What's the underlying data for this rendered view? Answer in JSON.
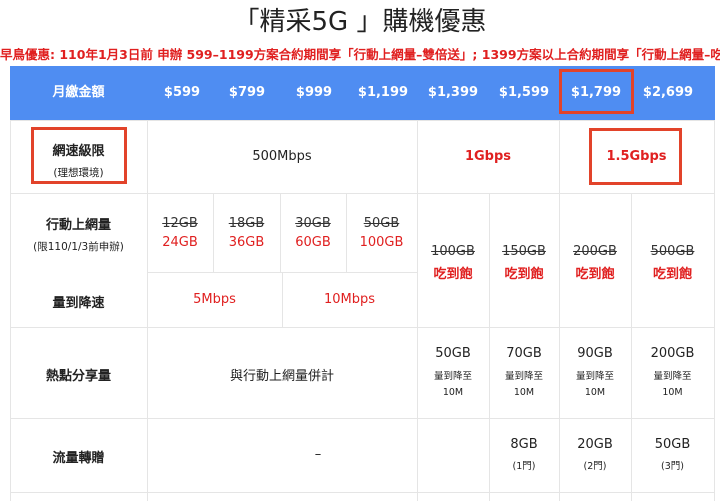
{
  "title": "「精采5G 」購機優惠",
  "promo": "早鳥優惠: 110年1月3日前 申辦 599–1199方案合約期間享「行動上網量–雙倍送」; 1399方案以上合約期間享「行動上網量–吃到飽",
  "header": {
    "label": "月繳金額",
    "prices": [
      "$599",
      "$799",
      "$999",
      "$1,199",
      "$1,399",
      "$1,599",
      "$1,799",
      "$2,699"
    ]
  },
  "speed_limit": {
    "label": "網速級限",
    "sublabel": "(理想環境)",
    "v1": "500Mbps",
    "v2": "1Gbps",
    "v3": "1.5Gbps"
  },
  "data_row": {
    "label": "行動上網量",
    "sublabel": "(限110/1/3前申辦)",
    "old": [
      "12GB",
      "18GB",
      "30GB",
      "50GB",
      "100GB",
      "150GB",
      "200GB",
      "500GB"
    ],
    "new": [
      "24GB",
      "36GB",
      "60GB",
      "100GB",
      "吃到飽",
      "吃到飽",
      "吃到飽",
      "吃到飽"
    ]
  },
  "throttle": {
    "label": "量到降速",
    "v1": "5Mbps",
    "v2": "10Mbps"
  },
  "hotspot": {
    "label": "熱點分享量",
    "shared": "與行動上網量併計",
    "values": [
      "50GB",
      "70GB",
      "90GB",
      "200GB"
    ],
    "note1": "量到降至",
    "note2": "10M"
  },
  "gift": {
    "label": "流量轉贈",
    "dash": "–",
    "values": [
      "8GB",
      "20GB",
      "50GB"
    ],
    "doors": [
      "(1門)",
      "(2門)",
      "(3門)"
    ]
  },
  "colors": {
    "band": "#4f8df2",
    "accent": "#e02020",
    "highlight": "#e2432a"
  }
}
